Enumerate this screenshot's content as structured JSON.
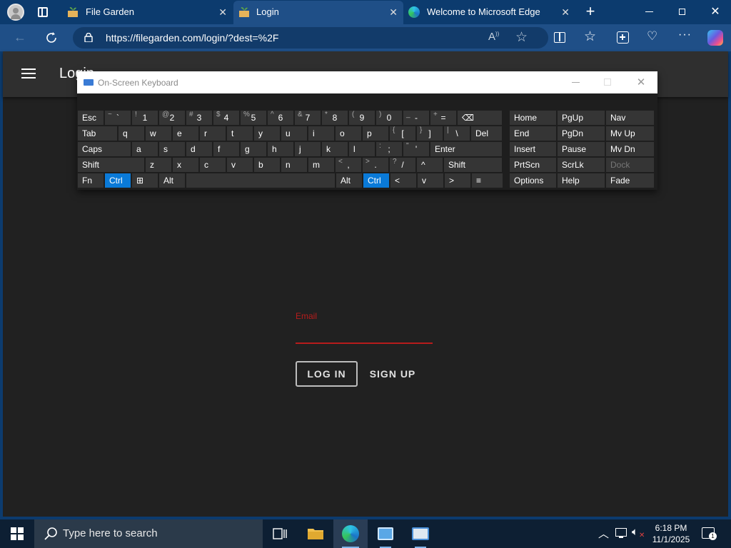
{
  "browser": {
    "tabs": [
      {
        "title": "File Garden"
      },
      {
        "title": "Login"
      },
      {
        "title": "Welcome to Microsoft Edge"
      }
    ],
    "url": "https://filegarden.com/login/?dest=%2F"
  },
  "page": {
    "appbar_title": "Login",
    "email_label": "Email",
    "email_value": "",
    "login_button": "LOG IN",
    "signup_button": "SIGN UP"
  },
  "keyboard": {
    "title": "On-Screen Keyboard",
    "rows": [
      [
        {
          "m": "Esc",
          "w": 36
        },
        {
          "s": "~",
          "m": "`",
          "w": 36
        },
        {
          "s": "!",
          "m": "1",
          "w": 36
        },
        {
          "s": "@",
          "m": "2",
          "w": 36
        },
        {
          "s": "#",
          "m": "3",
          "w": 36
        },
        {
          "s": "$",
          "m": "4",
          "w": 36
        },
        {
          "s": "%",
          "m": "5",
          "w": 36
        },
        {
          "s": "^",
          "m": "6",
          "w": 36
        },
        {
          "s": "&",
          "m": "7",
          "w": 36
        },
        {
          "s": "*",
          "m": "8",
          "w": 36
        },
        {
          "s": "(",
          "m": "9",
          "w": 36
        },
        {
          "s": ")",
          "m": "0",
          "w": 36
        },
        {
          "s": "_",
          "m": "-",
          "w": 36
        },
        {
          "s": "+",
          "m": "=",
          "w": 36
        },
        {
          "m": "⌫",
          "w": 62
        }
      ],
      [
        {
          "m": "Tab",
          "w": 55
        },
        {
          "m": "q",
          "w": 36
        },
        {
          "m": "w",
          "w": 36
        },
        {
          "m": "e",
          "w": 36
        },
        {
          "m": "r",
          "w": 36
        },
        {
          "m": "t",
          "w": 36
        },
        {
          "m": "y",
          "w": 36
        },
        {
          "m": "u",
          "w": 36
        },
        {
          "m": "i",
          "w": 36
        },
        {
          "m": "o",
          "w": 36
        },
        {
          "m": "p",
          "w": 36
        },
        {
          "s": "{",
          "m": "[",
          "w": 36
        },
        {
          "s": "}",
          "m": "]",
          "w": 36
        },
        {
          "s": "|",
          "m": "\\",
          "w": 36
        },
        {
          "m": "Del",
          "w": 43
        }
      ],
      [
        {
          "m": "Caps",
          "w": 74
        },
        {
          "m": "a",
          "w": 36
        },
        {
          "m": "s",
          "w": 36
        },
        {
          "m": "d",
          "w": 36
        },
        {
          "m": "f",
          "w": 36
        },
        {
          "m": "g",
          "w": 36
        },
        {
          "m": "h",
          "w": 36
        },
        {
          "m": "j",
          "w": 36
        },
        {
          "m": "k",
          "w": 36
        },
        {
          "m": "l",
          "w": 36
        },
        {
          "s": ":",
          "m": ";",
          "w": 36
        },
        {
          "s": "\"",
          "m": "'",
          "w": 36
        },
        {
          "m": "Enter",
          "w": 100
        }
      ],
      [
        {
          "m": "Shift",
          "w": 93
        },
        {
          "m": "z",
          "w": 36
        },
        {
          "m": "x",
          "w": 36
        },
        {
          "m": "c",
          "w": 36
        },
        {
          "m": "v",
          "w": 36
        },
        {
          "m": "b",
          "w": 36
        },
        {
          "m": "n",
          "w": 36
        },
        {
          "m": "m",
          "w": 36
        },
        {
          "s": "<",
          "m": ",",
          "w": 36
        },
        {
          "s": ">",
          "m": ".",
          "w": 36
        },
        {
          "s": "?",
          "m": "/",
          "w": 36
        },
        {
          "m": "^",
          "w": 36
        },
        {
          "m": "Shift",
          "w": 81
        }
      ],
      [
        {
          "m": "Fn",
          "w": 36
        },
        {
          "m": "Ctrl",
          "w": 36,
          "sel": true
        },
        {
          "m": "⊞",
          "w": 36
        },
        {
          "m": "Alt",
          "w": 36
        },
        {
          "m": "",
          "w": 208
        },
        {
          "m": "Alt",
          "w": 36
        },
        {
          "m": "Ctrl",
          "w": 36,
          "sel": true
        },
        {
          "m": "<",
          "w": 36
        },
        {
          "m": "v",
          "w": 36
        },
        {
          "m": ">",
          "w": 36
        },
        {
          "m": "≡",
          "w": 43
        }
      ]
    ],
    "nav": [
      [
        "Home",
        "PgUp",
        "Nav"
      ],
      [
        "End",
        "PgDn",
        "Mv Up"
      ],
      [
        "Insert",
        "Pause",
        "Mv Dn"
      ],
      [
        "PrtScn",
        "ScrLk",
        "Dock"
      ],
      [
        "Options",
        "Help",
        "Fade"
      ]
    ]
  },
  "taskbar": {
    "search_placeholder": "Type here to search",
    "time": "6:18 PM",
    "date": "11/1/2025"
  },
  "colors": {
    "accent": "#0a7ad8",
    "error": "#b71c1c"
  }
}
